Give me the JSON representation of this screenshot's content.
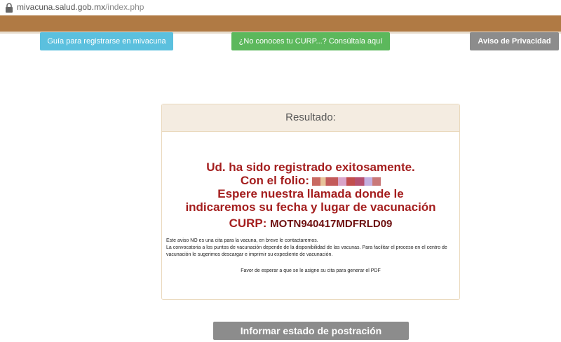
{
  "browser": {
    "url_domain": "mivacuna.salud.gob.mx",
    "url_path": "/index.php"
  },
  "header": {
    "guide_button": "Guía para registrarse en mivacuna",
    "curp_button": "¿No conoces tu CURP...? Consúltala aquí",
    "privacy_button": "Aviso de Privacidad"
  },
  "result": {
    "title": "Resultado:",
    "line1": "Ud. ha sido registrado exitosamente.",
    "line2": "Con el folio:",
    "line3": "Espere nuestra llamada donde le",
    "line4": "indicaremos su fecha y lugar de vacunación",
    "curp_label": "CURP:",
    "curp_value": "MOTN940417MDFRLD09",
    "note1": "Este aviso NO es una cita para la vacuna, en breve le contactaremos.",
    "note2": "La convocatoria a los puntos de vacunación depende de la disponibilidad de las vacunas. Para facilitar el proceso en el centro de vacunación le sugerimos descargar e imprimir su expediente de vacunación.",
    "note3": "Favor de esperar a que se le asigne su cita para generar el PDF"
  },
  "footer": {
    "report_button": "Informar estado de postración"
  },
  "colors": {
    "band": "#b07a44",
    "guide": "#5bc0de",
    "curp": "#5cb85c",
    "privacy": "#8c8c8c",
    "message": "#a41e1e"
  },
  "icons": {
    "lock": "lock-icon"
  }
}
